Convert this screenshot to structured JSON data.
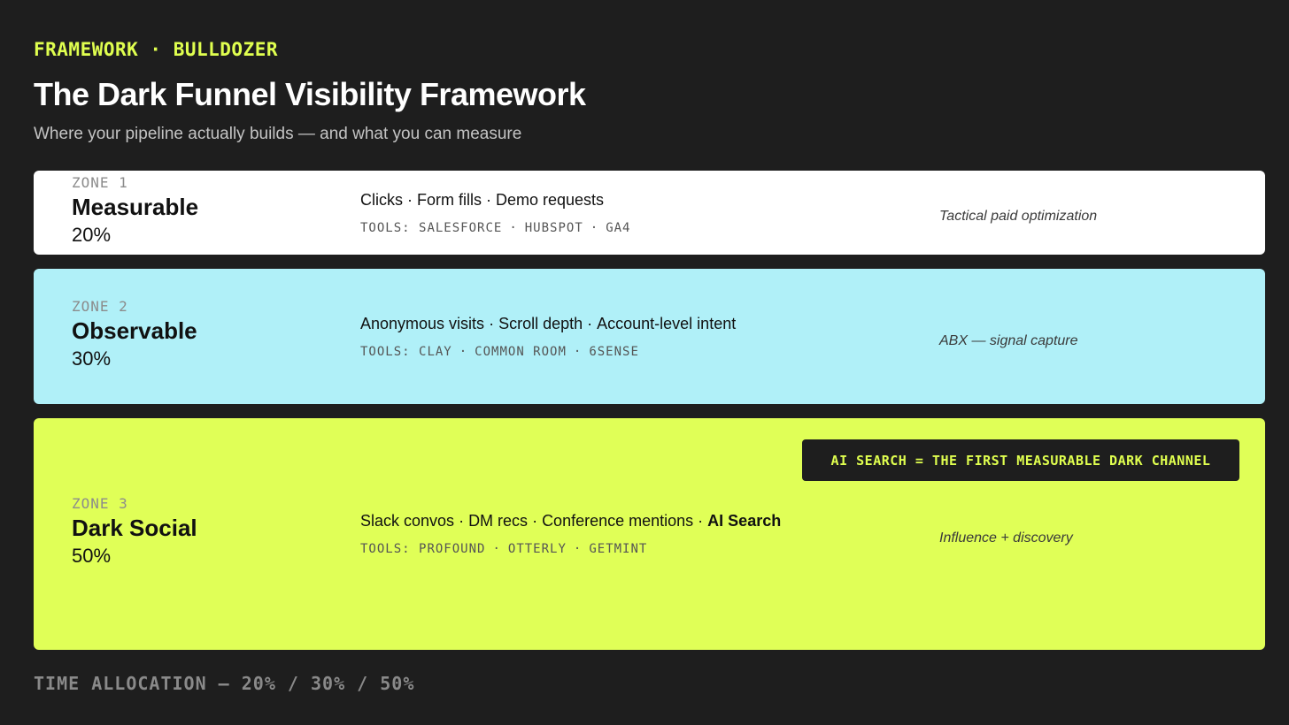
{
  "header": {
    "eyebrow": "FRAMEWORK · BULLDOZER",
    "title": "The Dark Funnel Visibility Framework",
    "subtitle": "Where your pipeline actually builds — and what you can measure"
  },
  "colors": {
    "background": "#1e1e1e",
    "accent": "#e0ff4f",
    "zone_1": "#ffffff",
    "zone_2": "#b0f0f8",
    "zone_3": "#e0ff57"
  },
  "zones": [
    {
      "index_label": "ZONE 1",
      "name": "Measurable",
      "percent": "20%",
      "share": 20,
      "signals": [
        {
          "text": "Clicks",
          "bold": false
        },
        {
          "text": "Form fills",
          "bold": false
        },
        {
          "text": "Demo requests",
          "bold": false
        }
      ],
      "tools_prefix": "TOOLS:",
      "tools": [
        "SALESFORCE",
        "HUBSPOT",
        "GA4"
      ],
      "note": "Tactical paid optimization",
      "color": "#ffffff"
    },
    {
      "index_label": "ZONE 2",
      "name": "Observable",
      "percent": "30%",
      "share": 30,
      "signals": [
        {
          "text": "Anonymous visits",
          "bold": false
        },
        {
          "text": "Scroll depth",
          "bold": false
        },
        {
          "text": "Account-level intent",
          "bold": false
        }
      ],
      "tools_prefix": "TOOLS:",
      "tools": [
        "CLAY",
        "COMMON ROOM",
        "6SENSE"
      ],
      "note": "ABX — signal capture",
      "color": "#b0f0f8"
    },
    {
      "index_label": "ZONE 3",
      "name": "Dark Social",
      "percent": "50%",
      "share": 50,
      "signals": [
        {
          "text": "Slack convos",
          "bold": false
        },
        {
          "text": "DM recs",
          "bold": false
        },
        {
          "text": "Conference mentions",
          "bold": false
        },
        {
          "text": "AI Search",
          "bold": true
        }
      ],
      "tools_prefix": "TOOLS:",
      "tools": [
        "PROFOUND",
        "OTTERLY",
        "GETMINT"
      ],
      "note": "Influence + discovery",
      "callout": "AI SEARCH = THE FIRST MEASURABLE DARK CHANNEL",
      "color": "#e0ff57"
    }
  ],
  "footer": {
    "text": "TIME ALLOCATION — 20% / 30% / 50%"
  }
}
